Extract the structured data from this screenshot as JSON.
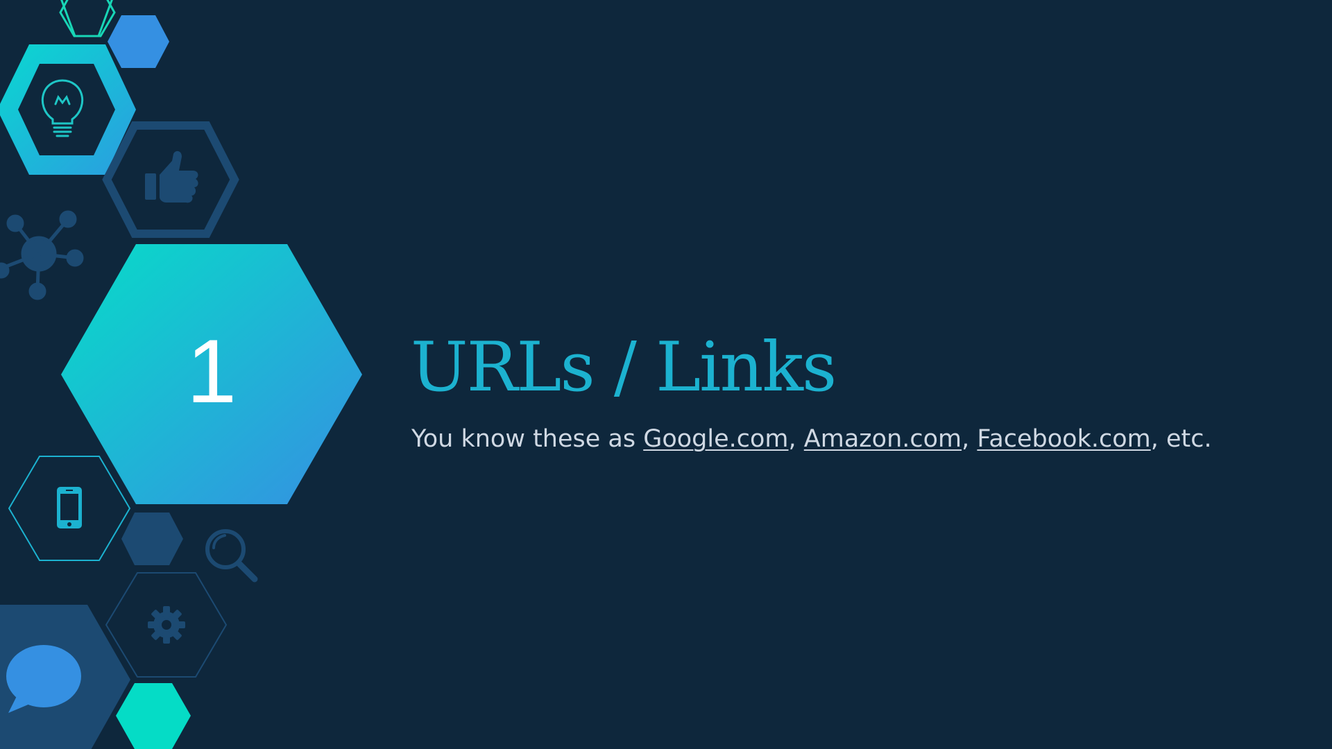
{
  "slide": {
    "number": "1",
    "title": "URLs / Links",
    "subtitle_prefix": "You know these as ",
    "links": [
      "Google.com",
      "Amazon.com",
      "Facebook.com"
    ],
    "separator": ", ",
    "subtitle_suffix": ", etc."
  },
  "colors": {
    "background": "#0e273c",
    "accent_teal": "#0ad8c8",
    "accent_blue": "#3090e0",
    "title": "#1cb2d0",
    "muted_navy": "#1c4a72"
  },
  "icons": [
    "lightbulb-icon",
    "thumbs-up-icon",
    "network-icon",
    "smartphone-icon",
    "search-icon",
    "gear-icon",
    "speech-bubble-icon"
  ]
}
